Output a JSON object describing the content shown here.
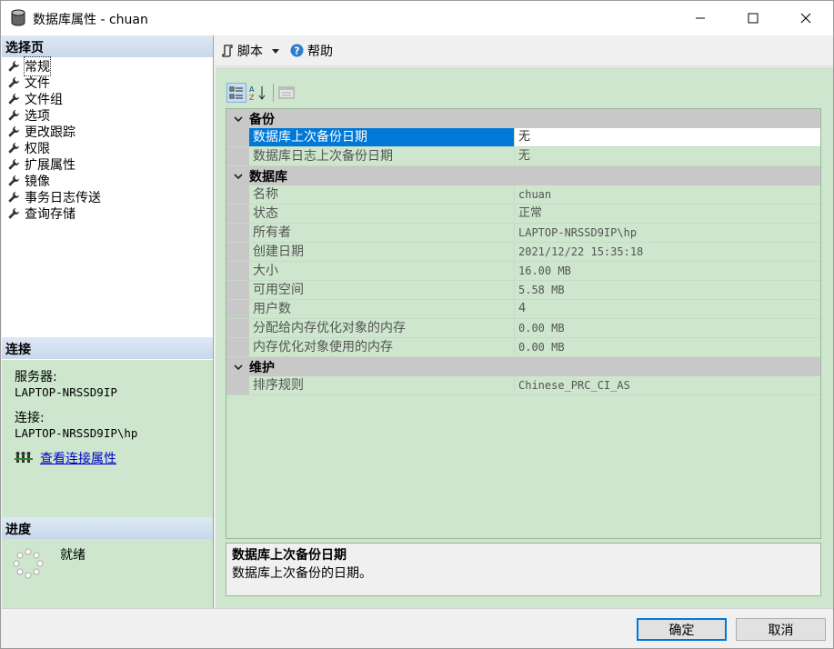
{
  "window": {
    "title": "数据库属性 - chuan"
  },
  "left": {
    "select_page_header": "选择页",
    "pages": [
      {
        "label": "常规",
        "selected": true
      },
      {
        "label": "文件"
      },
      {
        "label": "文件组"
      },
      {
        "label": "选项"
      },
      {
        "label": "更改跟踪"
      },
      {
        "label": "权限"
      },
      {
        "label": "扩展属性"
      },
      {
        "label": "镜像"
      },
      {
        "label": "事务日志传送"
      },
      {
        "label": "查询存储"
      }
    ],
    "connection_header": "连接",
    "connection": {
      "server_label": "服务器:",
      "server_value": "LAPTOP-NRSSD9IP",
      "conn_label": "连接:",
      "conn_value": "LAPTOP-NRSSD9IP\\hp",
      "view_link": "查看连接属性"
    },
    "progress_header": "进度",
    "progress_status": "就绪"
  },
  "toolbar": {
    "script_label": "脚本",
    "help_label": "帮助"
  },
  "propgrid": {
    "categories": [
      {
        "name": "备份",
        "rows": [
          {
            "name": "数据库上次备份日期",
            "value": "无",
            "selected": true
          },
          {
            "name": "数据库日志上次备份日期",
            "value": "无"
          }
        ]
      },
      {
        "name": "数据库",
        "rows": [
          {
            "name": "名称",
            "value": "chuan"
          },
          {
            "name": "状态",
            "value": "正常"
          },
          {
            "name": "所有者",
            "value": "LAPTOP-NRSSD9IP\\hp"
          },
          {
            "name": "创建日期",
            "value": "2021/12/22 15:35:18"
          },
          {
            "name": "大小",
            "value": "16.00 MB"
          },
          {
            "name": "可用空间",
            "value": "5.58 MB"
          },
          {
            "name": "用户数",
            "value": "4"
          },
          {
            "name": "分配给内存优化对象的内存",
            "value": "0.00 MB"
          },
          {
            "name": "内存优化对象使用的内存",
            "value": "0.00 MB"
          }
        ]
      },
      {
        "name": "维护",
        "rows": [
          {
            "name": "排序规则",
            "value": "Chinese_PRC_CI_AS"
          }
        ]
      }
    ]
  },
  "description": {
    "title": "数据库上次备份日期",
    "text": "数据库上次备份的日期。"
  },
  "footer": {
    "ok_label": "确定",
    "cancel_label": "取消"
  }
}
